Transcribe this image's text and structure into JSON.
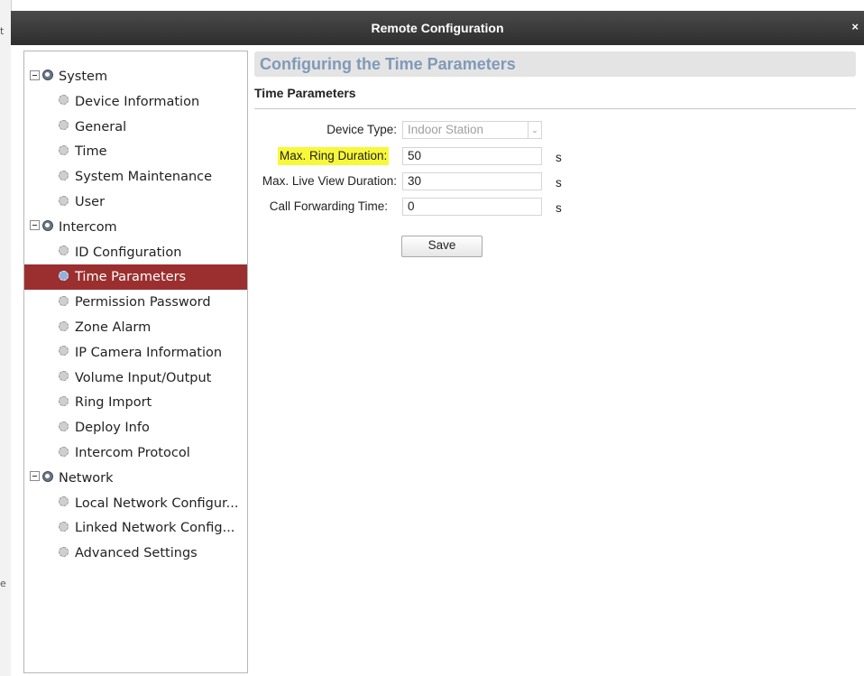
{
  "window": {
    "title": "Remote Configuration",
    "close_glyph": "×"
  },
  "background": {
    "edge_marks": [
      "t",
      "e"
    ]
  },
  "sidebar": {
    "groups": [
      {
        "label": "System",
        "icon": "gear-icon",
        "children": [
          "Device Information",
          "General",
          "Time",
          "System Maintenance",
          "User"
        ]
      },
      {
        "label": "Intercom",
        "icon": "gear-icon",
        "children": [
          "ID Configuration",
          "Time Parameters",
          "Permission Password",
          "Zone Alarm",
          "IP Camera Information",
          "Volume Input/Output",
          "Ring Import",
          "Deploy Info",
          "Intercom Protocol"
        ]
      },
      {
        "label": "Network",
        "icon": "gear-icon",
        "children": [
          "Local Network Configur...",
          "Linked Network Config...",
          "Advanced Settings"
        ]
      }
    ],
    "selected": "Time Parameters"
  },
  "main": {
    "header_title": "Configuring the Time Parameters",
    "section_title": "Time Parameters",
    "fields": {
      "device_type": {
        "label": "Device Type:",
        "value": "Indoor Station"
      },
      "max_ring_duration": {
        "label": "Max. Ring Duration:",
        "value": "50",
        "unit": "s"
      },
      "max_live_view_duration": {
        "label": "Max. Live View Duration:",
        "value": "30",
        "unit": "s"
      },
      "call_forwarding_time": {
        "label": "Call Forwarding Time:",
        "value": "0",
        "unit": "s"
      }
    },
    "save_label": "Save"
  },
  "colors": {
    "titlebar": "#3a3a3a",
    "selected_item": "#9b2f30",
    "header_text": "#7f9ab8",
    "highlight": "#f8f83a"
  }
}
